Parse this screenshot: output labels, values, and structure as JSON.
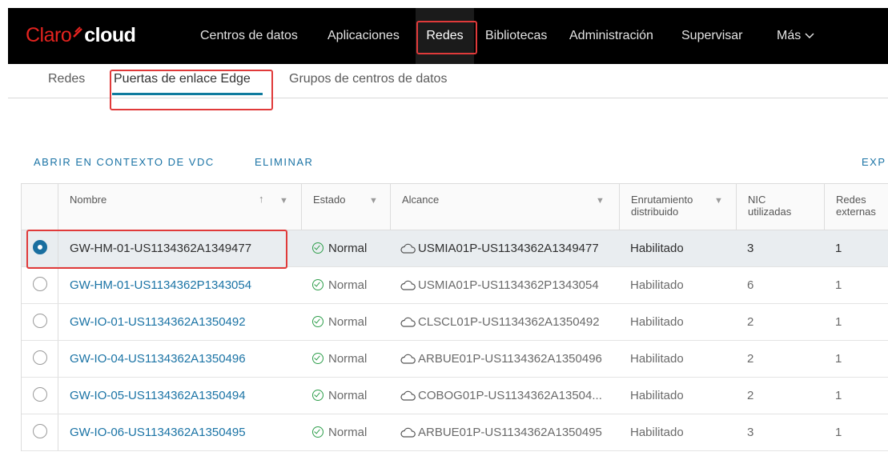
{
  "brand": {
    "claro": "Claro",
    "cloud": "cloud",
    "accent": "#e4231f"
  },
  "nav": {
    "items": [
      "Centros de datos",
      "Aplicaciones",
      "Redes",
      "Bibliotecas",
      "Administración",
      "Supervisar",
      "Más"
    ],
    "active": "Redes"
  },
  "subtabs": {
    "items": [
      "Redes",
      "Puertas de enlace Edge",
      "Grupos de centros de datos"
    ],
    "active": "Puertas de enlace Edge"
  },
  "actions": {
    "open_vdc": "ABRIR EN CONTEXTO DE VDC",
    "delete": "ELIMINAR",
    "export": "EXP"
  },
  "table": {
    "headers": {
      "name": "Nombre",
      "status": "Estado",
      "scope": "Alcance",
      "routing_1": "Enrutamiento",
      "routing_2": "distribuido",
      "nic_1": "NIC",
      "nic_2": "utilizadas",
      "ext_1": "Redes",
      "ext_2": "externas"
    },
    "rows": [
      {
        "name": "GW-HM-01-US1134362A1349477",
        "status": "Normal",
        "scope": "USMIA01P-US1134362A1349477",
        "routing": "Habilitado",
        "nic": "3",
        "ext": "1",
        "selected": true
      },
      {
        "name": "GW-HM-01-US1134362P1343054",
        "status": "Normal",
        "scope": "USMIA01P-US1134362P1343054",
        "routing": "Habilitado",
        "nic": "6",
        "ext": "1",
        "selected": false
      },
      {
        "name": "GW-IO-01-US1134362A1350492",
        "status": "Normal",
        "scope": "CLSCL01P-US1134362A1350492",
        "routing": "Habilitado",
        "nic": "2",
        "ext": "1",
        "selected": false
      },
      {
        "name": "GW-IO-04-US1134362A1350496",
        "status": "Normal",
        "scope": "ARBUE01P-US1134362A1350496",
        "routing": "Habilitado",
        "nic": "2",
        "ext": "1",
        "selected": false
      },
      {
        "name": "GW-IO-05-US1134362A1350494",
        "status": "Normal",
        "scope": "COBOG01P-US1134362A13504...",
        "routing": "Habilitado",
        "nic": "2",
        "ext": "1",
        "selected": false
      },
      {
        "name": "GW-IO-06-US1134362A1350495",
        "status": "Normal",
        "scope": "ARBUE01P-US1134362A1350495",
        "routing": "Habilitado",
        "nic": "3",
        "ext": "1",
        "selected": false
      }
    ]
  }
}
